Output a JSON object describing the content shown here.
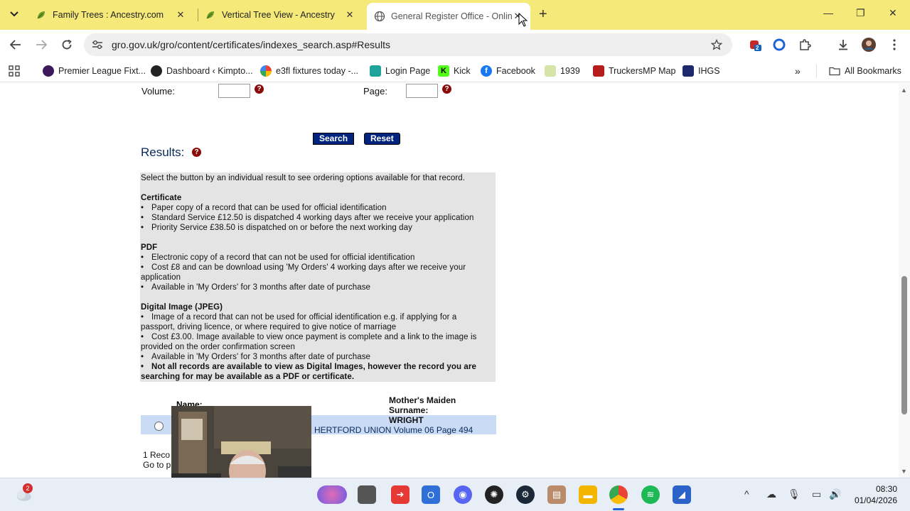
{
  "browser": {
    "tabs": [
      {
        "title": "Family Trees : Ancestry.com",
        "active": false
      },
      {
        "title": "Vertical Tree View - Ancestry",
        "active": false
      },
      {
        "title": "General Register Office - Online",
        "active": true
      }
    ],
    "url": "gro.gov.uk/gro/content/certificates/indexes_search.asp#Results",
    "extension_badge": "2",
    "bookmarks": [
      {
        "label": "Premier League Fixt...",
        "icon": "premier-league-icon",
        "color": "#3d195b"
      },
      {
        "label": "Dashboard ‹ Kimpto...",
        "icon": "wordpress-icon",
        "color": "#222222"
      },
      {
        "label": "e3fl fixtures today -...",
        "icon": "google-icon",
        "color": "#ea4335"
      },
      {
        "label": "Login Page",
        "icon": "login-page-icon",
        "color": "#1fa39a"
      },
      {
        "label": "Kick",
        "icon": "kick-icon",
        "color": "#53fc18"
      },
      {
        "label": "Facebook",
        "icon": "facebook-icon",
        "color": "#1877f2"
      },
      {
        "label": "1939",
        "icon": "1939-icon",
        "color": "#5a7a1a"
      },
      {
        "label": "TruckersMP Map",
        "icon": "truckersmp-icon",
        "color": "#b71c1c"
      },
      {
        "label": "IHGS",
        "icon": "ihgs-icon",
        "color": "#1c2a6b"
      }
    ],
    "all_bookmarks": "All Bookmarks"
  },
  "page": {
    "volume_label": "Volume:",
    "page_label": "Page:",
    "help_glyph": "?",
    "search_button": "Search",
    "reset_button": "Reset",
    "results_heading": "Results:",
    "info": {
      "intro": "Select the button by an individual result to see ordering options available for that record.",
      "certificate_heading": "Certificate",
      "certificate_items": [
        "Paper copy of a record that can be used for official identification",
        "Standard Service £12.50 is dispatched 4 working days after we receive your application",
        "Priority Service £38.50 is dispatched on or before the next working day"
      ],
      "pdf_heading": "PDF",
      "pdf_item_1": "Electronic copy of a record that can not be used for official identification",
      "pdf_item_2a": "Cost £8 and can be download using 'My Orders' 4 working days after we receive your",
      "pdf_item_2b": "application",
      "pdf_item_3": "Available in 'My Orders' for 3 months after date of purchase",
      "digital_heading": "Digital Image (JPEG)",
      "dig_item_1a": "Image of a record that can not be used for official identification e.g. if applying for a",
      "dig_item_1b": "passport, driving licence, or where required to give notice of marriage",
      "dig_item_2a": "Cost £3.00. Image available to view once payment is complete and a link to the image is",
      "dig_item_2b": "provided on the order confirmation screen",
      "dig_item_3": "Available in 'My Orders' for 3 months after date of purchase",
      "dig_item_4a": "Not all records are available to view as Digital Images, however the record you are",
      "dig_item_4b": "searching for may be available as a PDF or certificate."
    },
    "columns": {
      "name": "Name:",
      "mmn_line1": "Mother's Maiden",
      "mmn_line2": "Surname:"
    },
    "result": {
      "surname": "WRIGHT",
      "district": "HERTFORD UNION",
      "volume": "Volume 06",
      "page": "Page 494"
    },
    "footer_count": "1 Reco",
    "footer_goto": "Go to p"
  },
  "taskbar": {
    "chat_badge": "2",
    "time": "08:30",
    "date": "01/04/2026"
  }
}
